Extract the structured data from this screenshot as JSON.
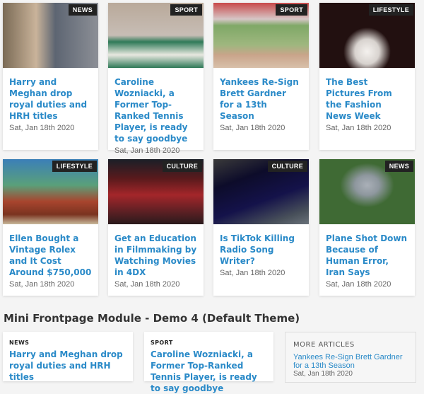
{
  "articles": [
    {
      "category": "NEWS",
      "title": "Harry and Meghan drop royal duties and HRH titles",
      "date": "Sat, Jan 18th 2020",
      "image": "couple-photo"
    },
    {
      "category": "SPORT",
      "title": "Caroline Wozniacki, a Former Top-Ranked Tennis Player, is ready to say goodbye",
      "date": "Sat, Jan 18th 2020",
      "image": "tennis-photo"
    },
    {
      "category": "SPORT",
      "title": "Yankees Re-Sign Brett Gardner for a 13th Season",
      "date": "Sat, Jan 18th 2020",
      "image": "baseball-photo"
    },
    {
      "category": "LIFESTYLE",
      "title": "The Best Pictures From the Fashion News Week",
      "date": "Sat, Jan 18th 2020",
      "image": "fashion-photo"
    },
    {
      "category": "LIFESTYLE",
      "title": "Ellen Bought a Vintage Rolex and It Cost Around $750,000",
      "date": "Sat, Jan 18th 2020",
      "image": "talkshow-photo"
    },
    {
      "category": "CULTURE",
      "title": "Get an Education in Filmmaking by Watching Movies in 4DX",
      "date": "Sat, Jan 18th 2020",
      "image": "cinema-photo"
    },
    {
      "category": "CULTURE",
      "title": "Is TikTok Killing Radio Song Writer?",
      "date": "Sat, Jan 18th 2020",
      "image": "phone-photo"
    },
    {
      "category": "NEWS",
      "title": "Plane Shot Down Because of Human Error, Iran Says",
      "date": "Sat, Jan 18th 2020",
      "image": "plane-photo"
    }
  ],
  "section_heading": "Mini Frontpage Module - Demo 4 (Default Theme)",
  "mini": [
    {
      "category": "NEWS",
      "title": "Harry and Meghan drop royal duties and HRH titles"
    },
    {
      "category": "SPORT",
      "title": "Caroline Wozniacki, a Former Top-Ranked Tennis Player, is ready to say goodbye"
    }
  ],
  "more_articles": {
    "heading": "MORE ARTICLES",
    "items": [
      {
        "title": "Yankees Re-Sign Brett Gardner for a 13th Season",
        "date": "Sat, Jan 18th 2020"
      }
    ]
  }
}
